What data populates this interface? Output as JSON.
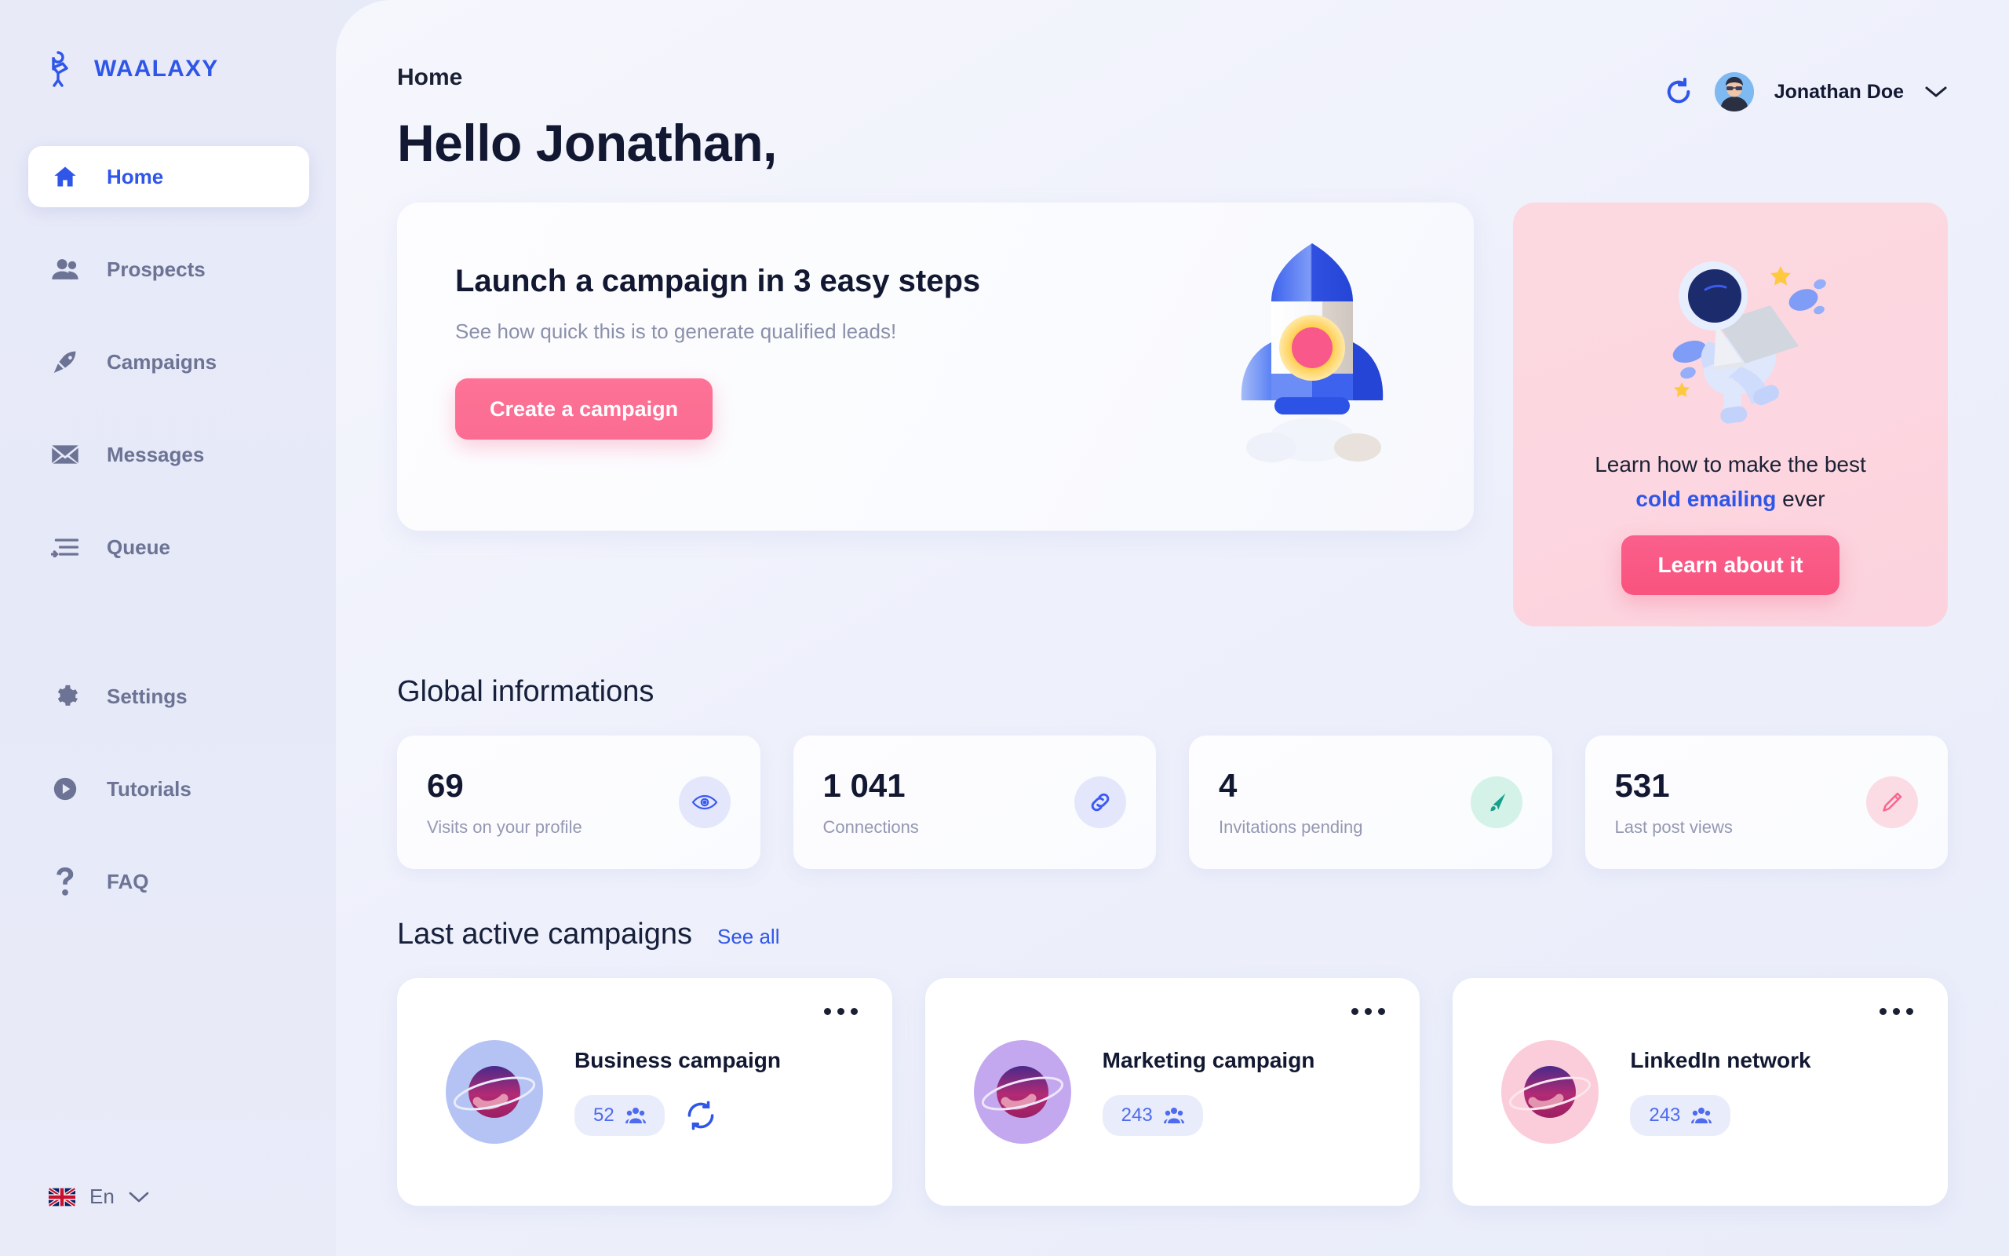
{
  "brand": {
    "name": "WAALAXY",
    "logo_icon": "waalaxy-flamingo-logo",
    "color": "#2f56e8"
  },
  "sidebar": {
    "primary_items": [
      {
        "label": "Home",
        "icon": "home-icon",
        "active": true
      },
      {
        "label": "Prospects",
        "icon": "people-icon",
        "active": false
      },
      {
        "label": "Campaigns",
        "icon": "rocket-icon",
        "active": false
      },
      {
        "label": "Messages",
        "icon": "envelope-icon",
        "active": false
      },
      {
        "label": "Queue",
        "icon": "queue-list-icon",
        "active": false
      }
    ],
    "secondary_items": [
      {
        "label": "Settings",
        "icon": "gear-icon"
      },
      {
        "label": "Tutorials",
        "icon": "play-circle-icon"
      },
      {
        "label": "FAQ",
        "icon": "question-mark-icon"
      }
    ],
    "language": {
      "label": "En",
      "flag_icon": "uk-flag-icon",
      "caret_icon": "chevron-down-icon"
    }
  },
  "header": {
    "breadcrumb": "Home",
    "greeting": "Hello Jonathan,",
    "refresh_icon": "refresh-icon",
    "user_name": "Jonathan Doe",
    "user_caret_icon": "chevron-down-icon",
    "avatar_icon": "user-avatar"
  },
  "launch_card": {
    "title": "Launch a campaign in 3 easy steps",
    "subtitle": "See how quick this is to generate qualified leads!",
    "button_label": "Create a campaign",
    "button_color": "#fb6c92",
    "illustration": "rocket-illustration"
  },
  "promo_card": {
    "line1": "Learn how to make the best",
    "highlight": "cold emailing",
    "line2_suffix": " ever",
    "button_label": "Learn about it",
    "background_color": "#fcd6e0",
    "button_color": "#f9537f",
    "illustration": "astronaut-with-laptop-illustration"
  },
  "global_info": {
    "title": "Global informations",
    "stats": [
      {
        "value": "69",
        "label": "Visits on your profile",
        "icon": "eye-icon",
        "icon_bg": "#e4e7fb",
        "icon_color": "#3b5bf0"
      },
      {
        "value": "1 041",
        "label": "Connections",
        "icon": "link-icon",
        "icon_bg": "#e4e7fb",
        "icon_color": "#3b5bf0"
      },
      {
        "value": "4",
        "label": "Invitations pending",
        "icon": "send-icon",
        "icon_bg": "#d5f2e9",
        "icon_color": "#19a08c"
      },
      {
        "value": "531",
        "label": "Last post views",
        "icon": "pencil-icon",
        "icon_bg": "#fbdce4",
        "icon_color": "#f9668e"
      }
    ]
  },
  "campaigns_section": {
    "title": "Last active campaigns",
    "see_all_label": "See all",
    "cards": [
      {
        "name": "Business campaign",
        "count": "52",
        "halo_color": "#b4c2f4",
        "has_sync": true,
        "menu_icon": "more-options-icon",
        "people_icon": "people-icon",
        "sync_icon": "sync-icon"
      },
      {
        "name": "Marketing campaign",
        "count": "243",
        "halo_color": "#c3a8ef",
        "has_sync": false,
        "menu_icon": "more-options-icon",
        "people_icon": "people-icon"
      },
      {
        "name": "LinkedIn network",
        "count": "243",
        "halo_color": "#fbccd9",
        "has_sync": false,
        "menu_icon": "more-options-icon",
        "people_icon": "people-icon"
      }
    ]
  }
}
